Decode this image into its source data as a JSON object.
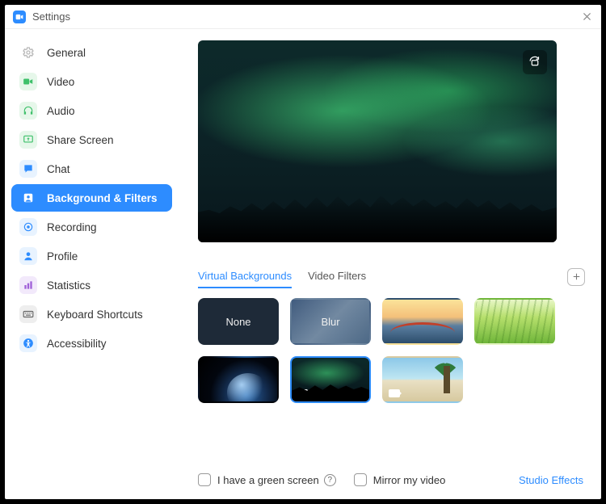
{
  "window": {
    "title": "Settings"
  },
  "sidebar": {
    "items": [
      {
        "label": "General"
      },
      {
        "label": "Video"
      },
      {
        "label": "Audio"
      },
      {
        "label": "Share Screen"
      },
      {
        "label": "Chat"
      },
      {
        "label": "Background & Filters"
      },
      {
        "label": "Recording"
      },
      {
        "label": "Profile"
      },
      {
        "label": "Statistics"
      },
      {
        "label": "Keyboard Shortcuts"
      },
      {
        "label": "Accessibility"
      }
    ],
    "active_index": 5
  },
  "tabs": {
    "virtual_backgrounds": "Virtual Backgrounds",
    "video_filters": "Video Filters",
    "active": "virtual_backgrounds"
  },
  "thumbs": {
    "none": "None",
    "blur": "Blur",
    "selected": "aurora"
  },
  "footer": {
    "green_screen": "I have a green screen",
    "mirror": "Mirror my video",
    "studio_effects": "Studio Effects"
  }
}
